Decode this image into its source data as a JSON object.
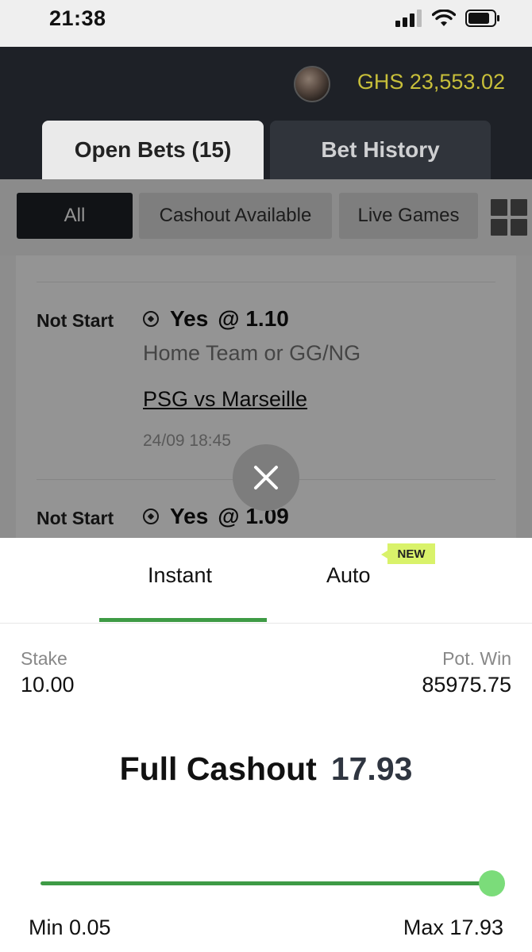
{
  "status_bar": {
    "time": "21:38"
  },
  "header": {
    "balance": "GHS 23,553.02",
    "avatar_icon": "user-avatar"
  },
  "tabs": {
    "open_bets": "Open Bets (15)",
    "bet_history": "Bet History"
  },
  "filters": {
    "all": "All",
    "cashout_available": "Cashout Available",
    "live_games": "Live Games"
  },
  "bets": [
    {
      "status": "Not Start",
      "pick": "Yes",
      "odds": "@ 1.10",
      "market": "Home Team or GG/NG",
      "match": "PSG vs Marseille",
      "date": "24/09 18:45"
    },
    {
      "status": "Not Start",
      "pick": "Yes",
      "odds": "@ 1.09"
    }
  ],
  "cashout_sheet": {
    "tab_instant": "Instant",
    "tab_auto": "Auto",
    "new_badge": "NEW",
    "stake_label": "Stake",
    "stake_value": "10.00",
    "potwin_label": "Pot. Win",
    "potwin_value": "85975.75",
    "full_cashout_label": "Full Cashout",
    "full_cashout_amount": "17.93",
    "min_label": "Min 0.05",
    "max_label": "Max 17.93",
    "slider_value": 17.93
  },
  "colors": {
    "accent_green": "#3e9b45",
    "balance_yellow": "#c8bf3a",
    "header_dark": "#1e2127",
    "badge_lime": "#d9f26a"
  }
}
